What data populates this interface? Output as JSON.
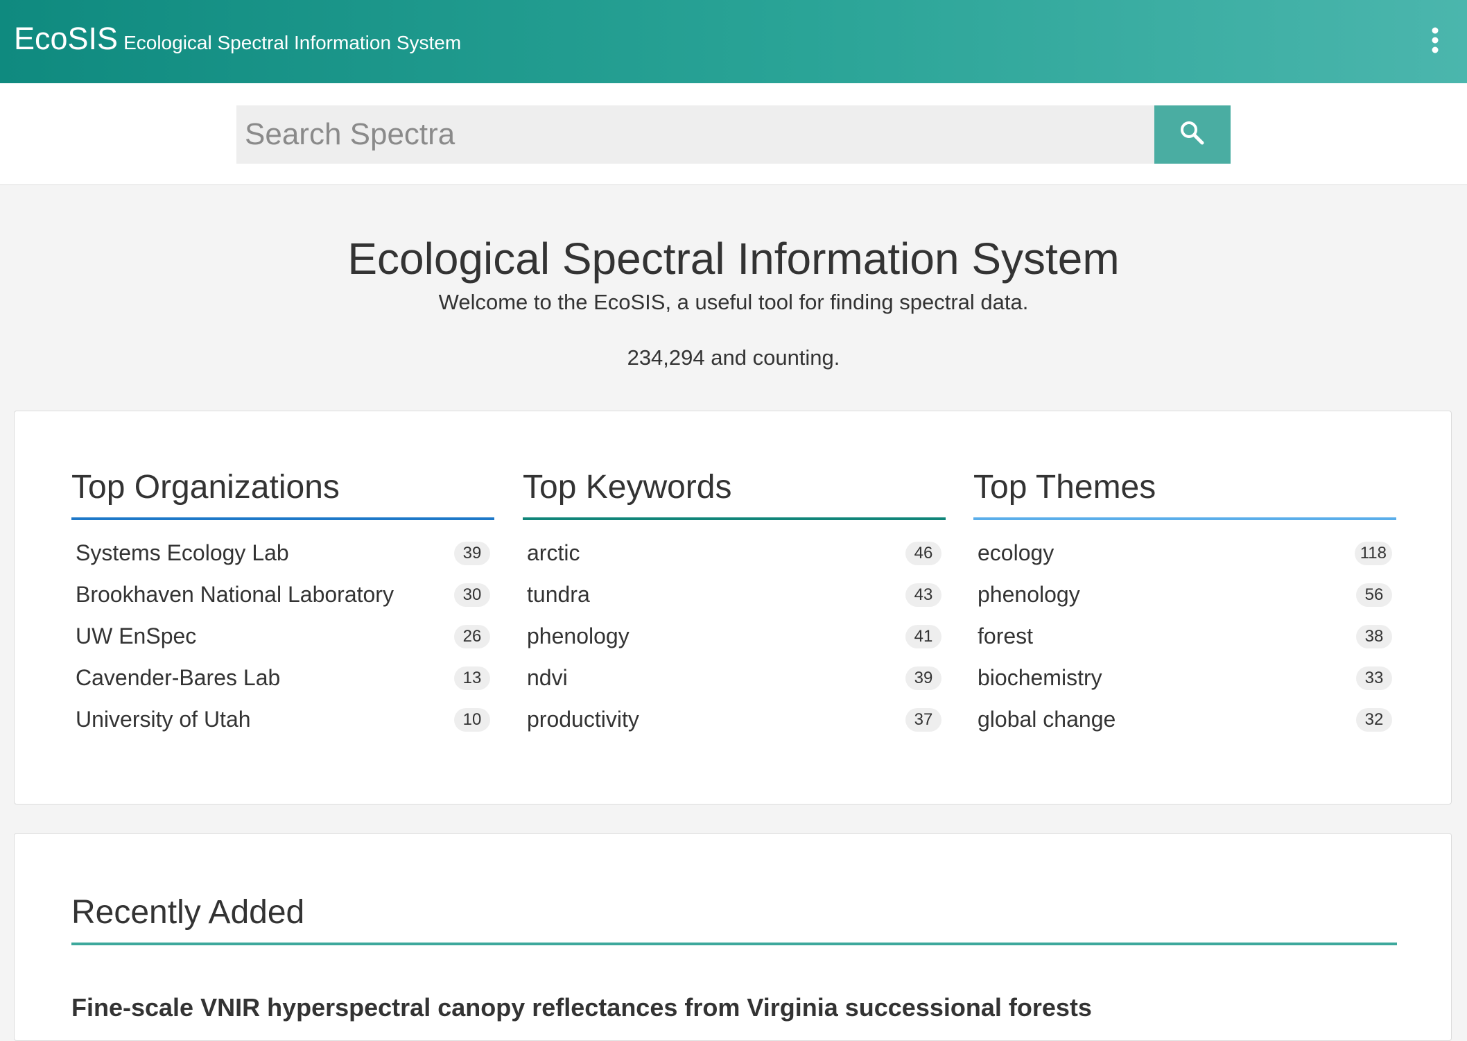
{
  "header": {
    "brand": "EcoSIS",
    "subtitle": "Ecological Spectral Information System",
    "menu_icon": "more-vert-icon"
  },
  "search": {
    "placeholder": "Search Spectra",
    "value": "",
    "button_icon": "search-icon"
  },
  "hero": {
    "title": "Ecological Spectral Information System",
    "welcome": "Welcome to the EcoSIS, a useful tool for finding spectral data.",
    "count_text": "234,294 and counting."
  },
  "top_organizations": {
    "heading": "Top Organizations",
    "items": [
      {
        "label": "Systems Ecology Lab",
        "count": "39"
      },
      {
        "label": "Brookhaven National Laboratory",
        "count": "30"
      },
      {
        "label": "UW EnSpec",
        "count": "26"
      },
      {
        "label": "Cavender-Bares Lab",
        "count": "13"
      },
      {
        "label": "University of Utah",
        "count": "10"
      }
    ]
  },
  "top_keywords": {
    "heading": "Top Keywords",
    "items": [
      {
        "label": "arctic",
        "count": "46"
      },
      {
        "label": "tundra",
        "count": "43"
      },
      {
        "label": "phenology",
        "count": "41"
      },
      {
        "label": "ndvi",
        "count": "39"
      },
      {
        "label": "productivity",
        "count": "37"
      }
    ]
  },
  "top_themes": {
    "heading": "Top Themes",
    "items": [
      {
        "label": "ecology",
        "count": "118"
      },
      {
        "label": "phenology",
        "count": "56"
      },
      {
        "label": "forest",
        "count": "38"
      },
      {
        "label": "biochemistry",
        "count": "33"
      },
      {
        "label": "global change",
        "count": "32"
      }
    ]
  },
  "recently_added": {
    "heading": "Recently Added",
    "items": [
      {
        "title": "Fine-scale VNIR hyperspectral canopy reflectances from Virginia successional forests"
      }
    ]
  },
  "colors": {
    "header_gradient_start": "#0f8a7f",
    "header_gradient_end": "#4bb6ad",
    "search_button": "#4aada2",
    "organizations_underline": "#1e78c8",
    "keywords_underline": "#108579",
    "themes_underline": "#5aaeea",
    "recent_underline": "#3da89c"
  }
}
